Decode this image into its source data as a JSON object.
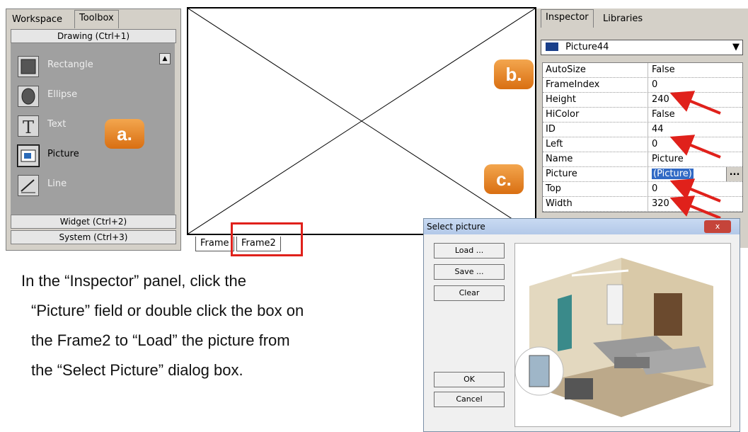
{
  "toolbox": {
    "tabs": [
      "Workspace",
      "Toolbox"
    ],
    "sections": {
      "drawing": "Drawing (Ctrl+1)",
      "widget": "Widget (Ctrl+2)",
      "system": "System (Ctrl+3)"
    },
    "tools": [
      {
        "label": "Rectangle",
        "icon": "rectangle-icon"
      },
      {
        "label": "Ellipse",
        "icon": "ellipse-icon"
      },
      {
        "label": "Text",
        "icon": "text-icon"
      },
      {
        "label": "Picture",
        "icon": "picture-icon"
      },
      {
        "label": "Line",
        "icon": "line-icon"
      }
    ],
    "selected_tool": "Picture"
  },
  "canvas": {
    "frame_tabs": [
      "Frame",
      "Frame2"
    ],
    "active_frame": "Frame2"
  },
  "inspector": {
    "tabs": [
      "Inspector",
      "Libraries"
    ],
    "object": "Picture44",
    "properties": [
      {
        "name": "AutoSize",
        "value": "False"
      },
      {
        "name": "FrameIndex",
        "value": "0"
      },
      {
        "name": "Height",
        "value": "240"
      },
      {
        "name": "HiColor",
        "value": "False"
      },
      {
        "name": "ID",
        "value": "44"
      },
      {
        "name": "Left",
        "value": "0"
      },
      {
        "name": "Name",
        "value": "Picture"
      },
      {
        "name": "Picture",
        "value": "(Picture)"
      },
      {
        "name": "Top",
        "value": "0"
      },
      {
        "name": "Width",
        "value": "320"
      }
    ],
    "ellipsis": "..."
  },
  "callouts": {
    "a": "a.",
    "b": "b.",
    "c": "c."
  },
  "dialog": {
    "title": "Select picture",
    "buttons": {
      "load": "Load ...",
      "save": "Save ...",
      "clear": "Clear",
      "ok": "OK",
      "cancel": "Cancel"
    },
    "close": "x"
  },
  "instructions": {
    "lines": [
      "In the “Inspector” panel, click the",
      "“Picture” field or double click the box on",
      "the Frame2 to “Load” the picture from",
      "the “Select Picture” dialog box."
    ]
  },
  "colors": {
    "callout": "#e8862a",
    "highlight": "#e0211b",
    "arrow": "#e0211b"
  }
}
